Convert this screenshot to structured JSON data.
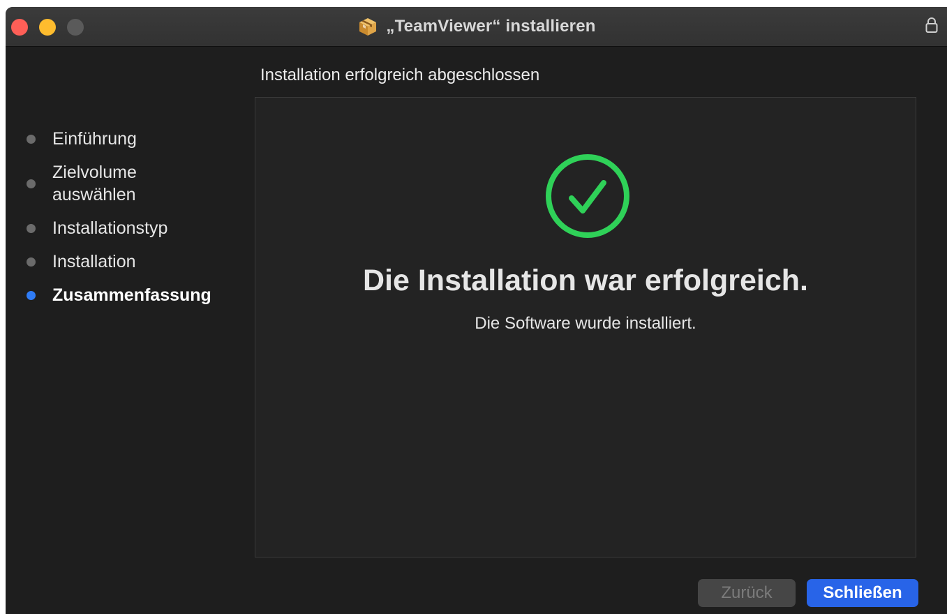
{
  "window": {
    "title": "„TeamViewer“ installieren",
    "title_icon": "package-icon",
    "lock_icon": "lock-icon"
  },
  "sidebar": {
    "steps": [
      {
        "label": "Einführung",
        "active": false
      },
      {
        "label": "Zielvolume auswählen",
        "line1": "Zielvolume",
        "line2": "auswählen",
        "active": false
      },
      {
        "label": "Installationstyp",
        "active": false
      },
      {
        "label": "Installation",
        "active": false
      },
      {
        "label": "Zusammenfassung",
        "active": true
      }
    ]
  },
  "main": {
    "heading": "Installation erfolgreich abgeschlossen",
    "success_icon": "checkmark-circle-icon",
    "success_title": "Die Installation war erfolgreich.",
    "success_subtitle": "Die Software wurde installiert."
  },
  "footer": {
    "back_label": "Zurück",
    "back_enabled": false,
    "close_label": "Schließen"
  },
  "colors": {
    "accent": "#2864e8",
    "active_step_dot": "#2f7cf6",
    "success_green": "#2fd158",
    "close_traffic": "#fe5f57",
    "minimize_traffic": "#febc2e"
  }
}
